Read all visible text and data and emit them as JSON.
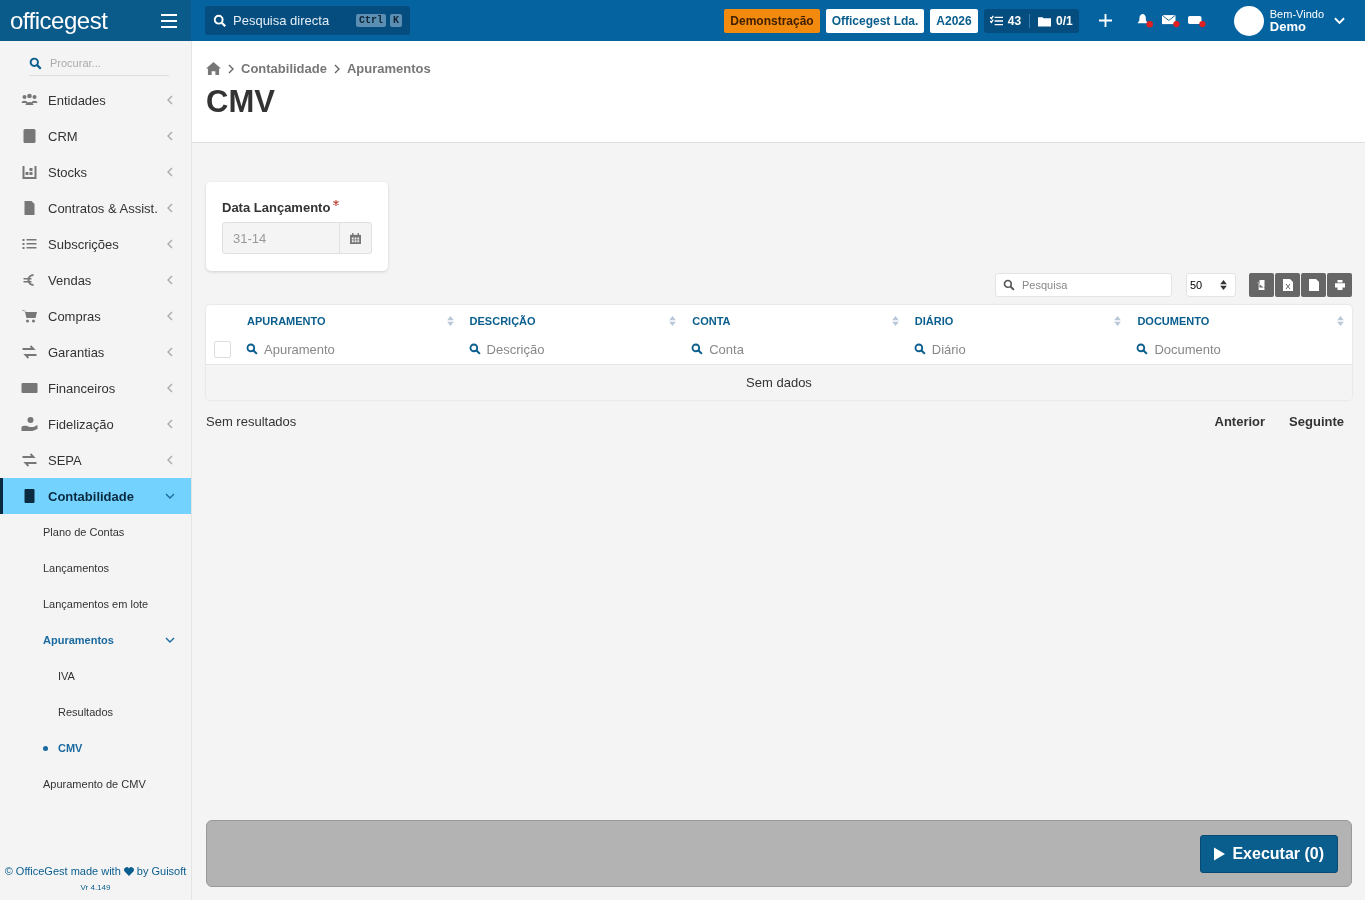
{
  "topbar": {
    "logo": "officegest",
    "search": {
      "placeholder": "Pesquisa directa",
      "keys": [
        "Ctrl",
        "K"
      ]
    },
    "badges": {
      "mode": "Demonstração",
      "company": "Officegest Lda.",
      "year": "A2026"
    },
    "tasks": "43",
    "folders": "0/1",
    "user": {
      "greeting": "Bem-Vindo",
      "name": "Demo"
    }
  },
  "sidebar": {
    "search": {
      "placeholder": "Procurar..."
    },
    "items": [
      {
        "label": "Entidades",
        "expanded": false,
        "selected": false
      },
      {
        "label": "CRM",
        "expanded": false,
        "selected": false
      },
      {
        "label": "Stocks",
        "expanded": false,
        "selected": false
      },
      {
        "label": "Contratos & Assist.",
        "expanded": false,
        "selected": false
      },
      {
        "label": "Subscrições",
        "expanded": false,
        "selected": false
      },
      {
        "label": "Vendas",
        "expanded": false,
        "selected": false
      },
      {
        "label": "Compras",
        "expanded": false,
        "selected": false
      },
      {
        "label": "Garantias",
        "expanded": false,
        "selected": false
      },
      {
        "label": "Financeiros",
        "expanded": false,
        "selected": false
      },
      {
        "label": "Fidelização",
        "expanded": false,
        "selected": false
      },
      {
        "label": "SEPA",
        "expanded": false,
        "selected": false
      },
      {
        "label": "Contabilidade",
        "expanded": true,
        "selected": true,
        "children": [
          {
            "label": "Plano de Contas",
            "selected": false
          },
          {
            "label": "Lançamentos",
            "selected": false
          },
          {
            "label": "Lançamentos em lote",
            "selected": false
          },
          {
            "label": "Apuramentos",
            "selected": true,
            "expanded": true,
            "children": [
              {
                "label": "IVA",
                "selected": false
              },
              {
                "label": "Resultados",
                "selected": false
              },
              {
                "label": "CMV",
                "selected": true
              }
            ]
          },
          {
            "label": "Apuramento de CMV",
            "selected": false
          }
        ]
      }
    ],
    "footer": {
      "before": "© OfficeGest made with",
      "after": "by Guisoft",
      "version": "Vr 4.149"
    }
  },
  "breadcrumb": [
    "Contabilidade",
    "Apuramentos"
  ],
  "title": "CMV",
  "form": {
    "label": "Data Lançamento",
    "required": true,
    "value": "31-14"
  },
  "table": {
    "search": {
      "placeholder": "Pesquisa"
    },
    "page_size": "50",
    "columns": [
      {
        "title": "APURAMENTO",
        "placeholder": "Apuramento"
      },
      {
        "title": "DESCRIÇÃO",
        "placeholder": "Descrição"
      },
      {
        "title": "CONTA",
        "placeholder": "Conta"
      },
      {
        "title": "DIÁRIO",
        "placeholder": "Diário"
      },
      {
        "title": "DOCUMENTO",
        "placeholder": "Documento"
      }
    ],
    "select_all": {
      "checked": false
    },
    "empty": "Sem dados",
    "status": "Sem resultados",
    "pager": [
      "Anterior",
      "Seguinte"
    ]
  },
  "action": "Executar (0)"
}
